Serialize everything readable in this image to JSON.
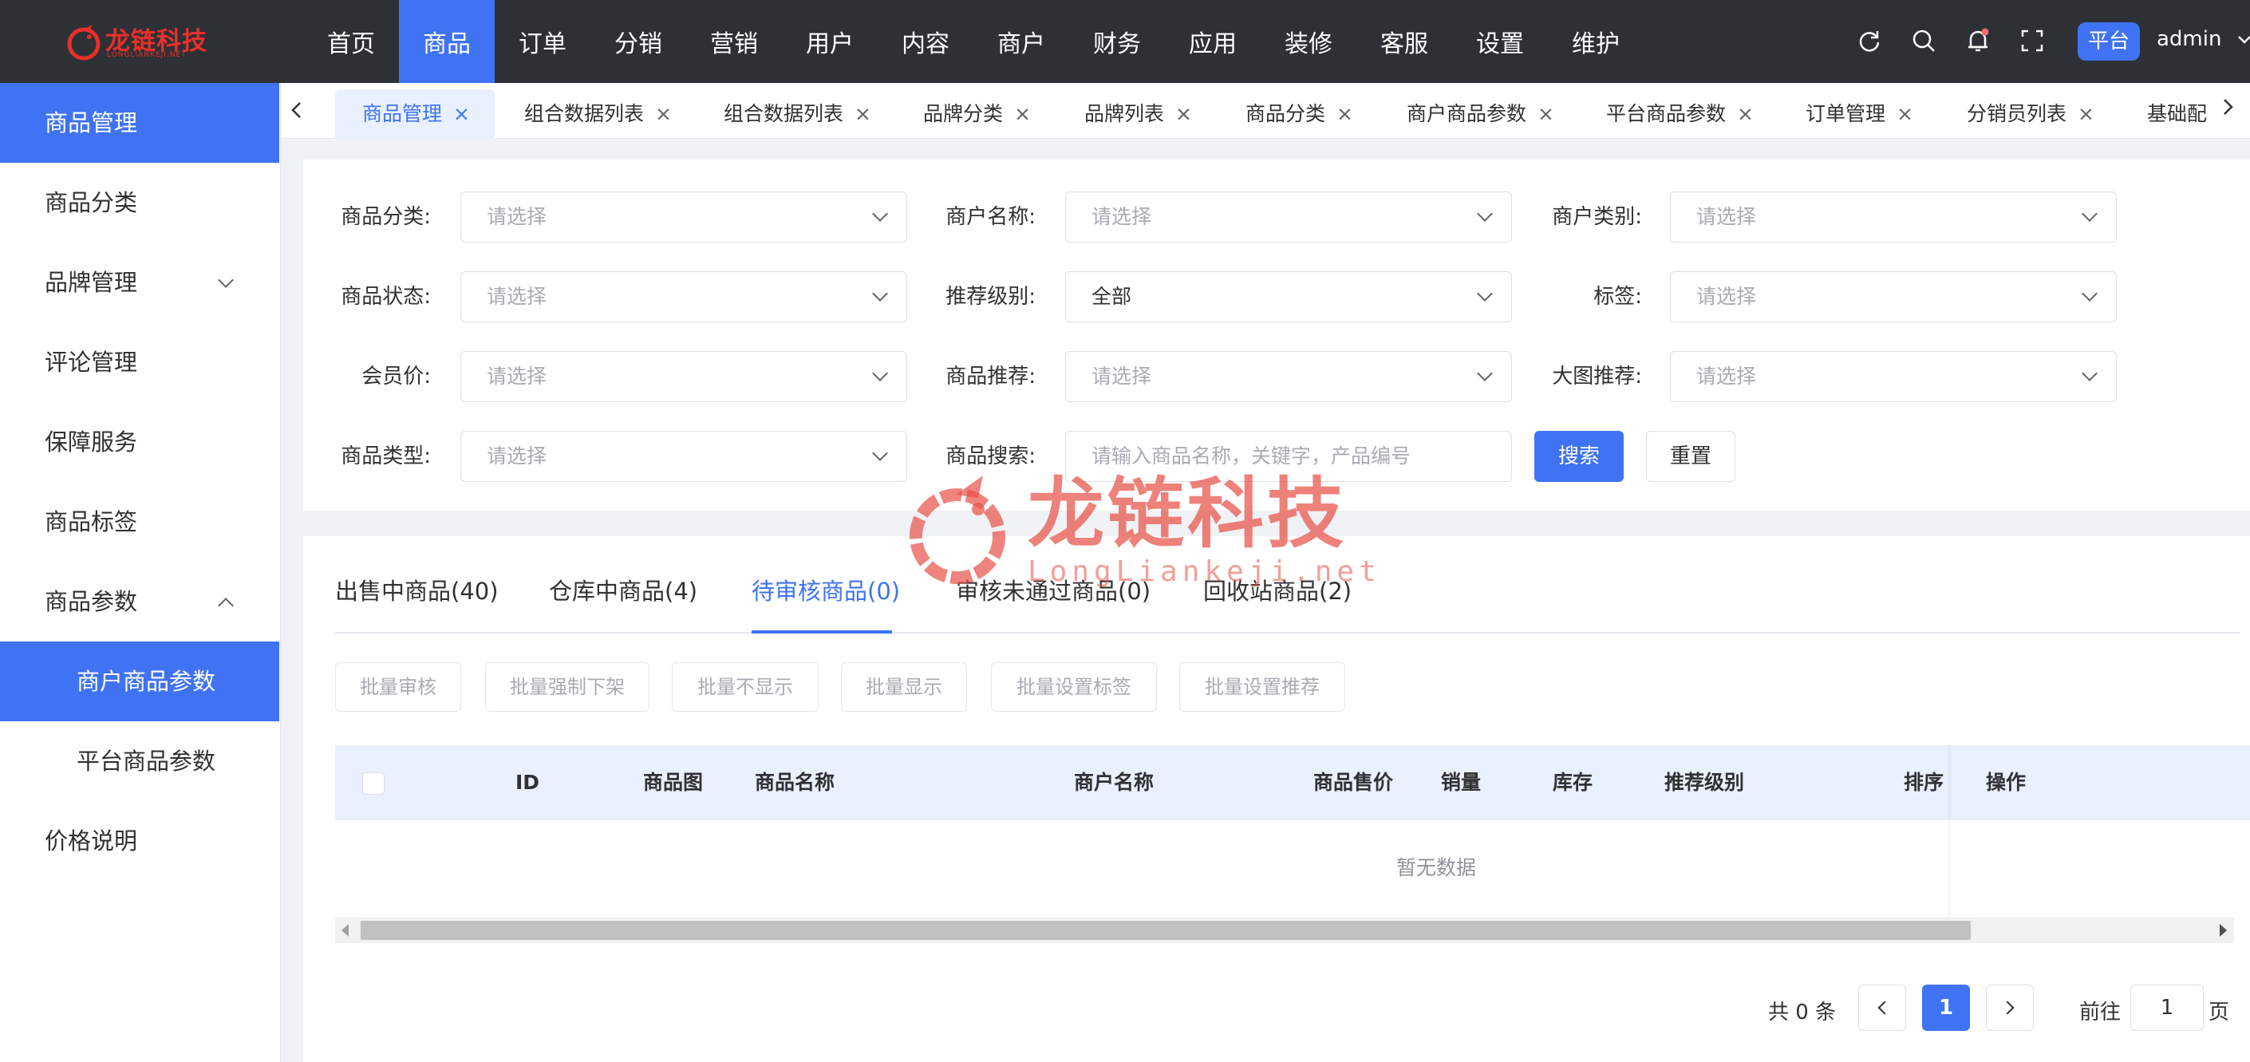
{
  "brand": {
    "name": "龙链科技",
    "sub": "LONGLIANKEJI.NET"
  },
  "topnav": [
    "首页",
    "商品",
    "订单",
    "分销",
    "营销",
    "用户",
    "内容",
    "商户",
    "财务",
    "应用",
    "装修",
    "客服",
    "设置",
    "维护"
  ],
  "topnav_active": "商品",
  "header": {
    "platform_label": "平台",
    "user": "admin"
  },
  "sidebar": {
    "items": [
      {
        "label": "商品管理",
        "active": true
      },
      {
        "label": "商品分类"
      },
      {
        "label": "品牌管理",
        "expandable": true
      },
      {
        "label": "评论管理"
      },
      {
        "label": "保障服务"
      },
      {
        "label": "商品标签"
      },
      {
        "label": "商品参数",
        "expanded": true
      },
      {
        "label": "商户商品参数",
        "sub": true,
        "active": true
      },
      {
        "label": "平台商品参数",
        "sub": true
      },
      {
        "label": "价格说明"
      }
    ]
  },
  "tabs": [
    "商品管理",
    "组合数据列表",
    "组合数据列表",
    "品牌分类",
    "品牌列表",
    "商品分类",
    "商户商品参数",
    "平台商品参数",
    "订单管理",
    "分销员列表",
    "基础配"
  ],
  "filters": {
    "category_label": "商品分类:",
    "category_placeholder": "请选择",
    "merchant_name_label": "商户名称:",
    "merchant_name_placeholder": "请选择",
    "merchant_type_label": "商户类别:",
    "merchant_type_placeholder": "请选择",
    "status_label": "商品状态:",
    "status_placeholder": "请选择",
    "recommend_level_label": "推荐级别:",
    "recommend_level_value": "全部",
    "tag_label": "标签:",
    "tag_placeholder": "请选择",
    "member_price_label": "会员价:",
    "member_price_placeholder": "请选择",
    "recommend_label": "商品推荐:",
    "recommend_placeholder": "请选择",
    "big_image_label": "大图推荐:",
    "big_image_placeholder": "请选择",
    "type_label": "商品类型:",
    "type_placeholder": "请选择",
    "search_label": "商品搜索:",
    "search_placeholder": "请输入商品名称，关键字，产品编号",
    "search_button": "搜索",
    "reset_button": "重置"
  },
  "status_tabs": [
    "出售中商品(40)",
    "仓库中商品(4)",
    "待审核商品(0)",
    "审核未通过商品(0)",
    "回收站商品(2)"
  ],
  "status_tab_active": "待审核商品(0)",
  "batch_buttons": [
    "批量审核",
    "批量强制下架",
    "批量不显示",
    "批量显示",
    "批量设置标签",
    "批量设置推荐"
  ],
  "table": {
    "columns": [
      "ID",
      "商品图",
      "商品名称",
      "商户名称",
      "商品售价",
      "销量",
      "库存",
      "推荐级别",
      "排序",
      "操作"
    ],
    "empty_text": "暂无数据"
  },
  "pagination": {
    "total": "共 0 条",
    "current": "1",
    "goto_label": "前往",
    "goto_value": "1",
    "page_unit": "页"
  },
  "watermark": {
    "text": "龙链科技",
    "sub": "LongLiankeji.net"
  },
  "colors": {
    "primary": "#3f73f4",
    "topbar": "#2d3035",
    "brand": "#e7302a",
    "watermark": "#e75046"
  }
}
